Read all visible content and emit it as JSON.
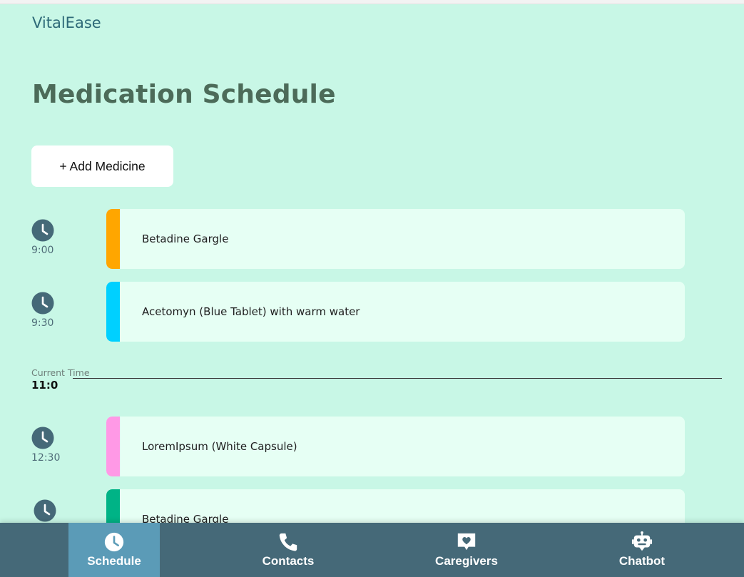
{
  "app": {
    "brand": "VitalEase"
  },
  "page": {
    "title": "Medication Schedule",
    "add_button": "+ Add Medicine"
  },
  "schedule": [
    {
      "time": "9:00",
      "name": "Betadine Gargle",
      "color": "#ffa600"
    },
    {
      "time": "9:30",
      "name": "Acetomyn (Blue Tablet) with warm water",
      "color": "#00d0ff"
    },
    {
      "time": "12:30",
      "name": "LoremIpsum (White Capsule)",
      "color": "#ff99e6"
    },
    {
      "time": "",
      "name": "Betadine Gargle",
      "color": "#00b386"
    }
  ],
  "current_time": {
    "label": "Current Time",
    "value": "11:0"
  },
  "nav": [
    {
      "label": "Schedule",
      "icon": "clock-icon",
      "active": true
    },
    {
      "label": "Contacts",
      "icon": "phone-icon",
      "active": false
    },
    {
      "label": "Caregivers",
      "icon": "heart-chat-icon",
      "active": false
    },
    {
      "label": "Chatbot",
      "icon": "robot-icon",
      "active": false
    }
  ],
  "colors": {
    "background": "#c8f7e6",
    "card": "#e6fff4",
    "nav": "#456978",
    "nav_active": "#5b9bb7"
  }
}
